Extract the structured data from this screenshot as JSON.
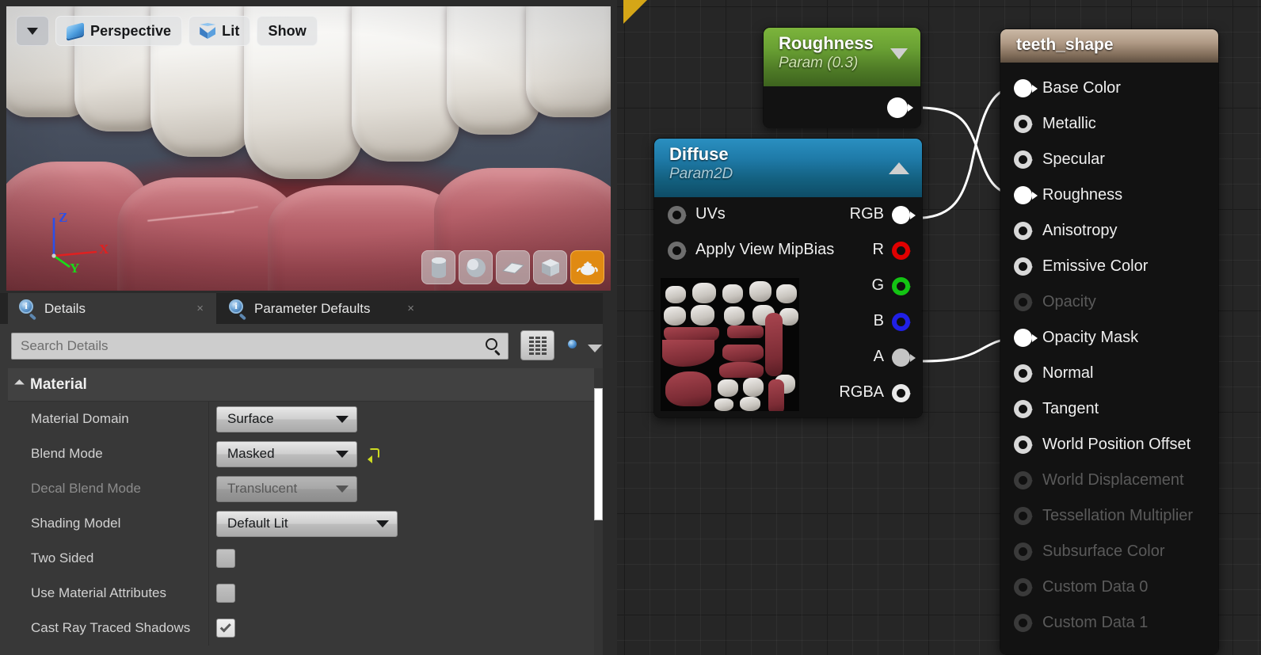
{
  "viewport": {
    "toolbar": {
      "menu_icon": "chevron-down-icon",
      "perspective_label": "Perspective",
      "perspective_icon": "perspective-icon",
      "lit_label": "Lit",
      "lit_icon": "lit-cube-icon",
      "show_label": "Show"
    },
    "gizmo": {
      "x_label": "X",
      "y_label": "Y",
      "z_label": "Z",
      "x_color": "#e02020",
      "y_color": "#18dc18",
      "z_color": "#2b4fe8"
    },
    "primitives": [
      {
        "name": "cylinder",
        "active": false
      },
      {
        "name": "sphere",
        "active": false
      },
      {
        "name": "plane",
        "active": false
      },
      {
        "name": "cube",
        "active": false
      },
      {
        "name": "teapot",
        "active": true
      }
    ],
    "primitive_active_color": "#e08a12"
  },
  "details": {
    "tabs": [
      {
        "label": "Details",
        "icon": "details-icon",
        "active": true,
        "close": "×"
      },
      {
        "label": "Parameter Defaults",
        "icon": "details-icon",
        "active": false,
        "close": "×"
      }
    ],
    "search": {
      "placeholder": "Search Details",
      "value": "",
      "icon": "search-icon"
    },
    "view_buttons": [
      {
        "name": "grid-view-button",
        "icon": "grid-icon"
      },
      {
        "name": "visibility-button",
        "icon": "eye-icon"
      },
      {
        "name": "view-options-dropdown",
        "icon": "chevron-down-icon"
      }
    ],
    "category": "Material",
    "rows": [
      {
        "name": "Material Domain",
        "type": "combo",
        "value": "Surface",
        "width": "w178",
        "disabled": false,
        "revert": false
      },
      {
        "name": "Blend Mode",
        "type": "combo",
        "value": "Masked",
        "width": "w178",
        "disabled": false,
        "revert": true
      },
      {
        "name": "Decal Blend Mode",
        "type": "combo",
        "value": "Translucent",
        "width": "w178",
        "disabled": true,
        "revert": false
      },
      {
        "name": "Shading Model",
        "type": "combo",
        "value": "Default Lit",
        "width": "w229",
        "disabled": false,
        "revert": false
      },
      {
        "name": "Two Sided",
        "type": "checkbox",
        "checked": false,
        "disabled": false,
        "revert": false
      },
      {
        "name": "Use Material Attributes",
        "type": "checkbox",
        "checked": false,
        "disabled": false,
        "revert": false
      },
      {
        "name": "Cast Ray Traced Shadows",
        "type": "checkbox",
        "checked": true,
        "disabled": false,
        "revert": false
      }
    ]
  },
  "graph": {
    "nodes": {
      "roughness": {
        "title": "Roughness",
        "subtitle": "Param (0.3)",
        "header_color": "#69a033",
        "collapse_icon": "chevron-down-icon",
        "output_pin": "roughness-output-pin"
      },
      "diffuse": {
        "title": "Diffuse",
        "subtitle": "Param2D",
        "header_color": "#1f7ba9",
        "collapse_icon": "chevron-up-icon",
        "inputs": [
          {
            "label": "UVs"
          },
          {
            "label": "Apply View MipBias"
          }
        ],
        "outputs": [
          {
            "label": "RGB",
            "style": "white",
            "connected": true
          },
          {
            "label": "R",
            "style": "ring r",
            "connected": false
          },
          {
            "label": "G",
            "style": "ring g",
            "connected": false
          },
          {
            "label": "B",
            "style": "ring b",
            "connected": false
          },
          {
            "label": "A",
            "style": "greyfill",
            "connected": true
          },
          {
            "label": "RGBA",
            "style": "ring w",
            "connected": false
          }
        ],
        "thumbnail": "teeth-texture-atlas-thumbnail"
      },
      "result": {
        "title": "teeth_shape",
        "header_color": "#b09a85",
        "pins": [
          {
            "label": "Base Color",
            "connected": true,
            "disabled": false
          },
          {
            "label": "Metallic",
            "connected": false,
            "disabled": false
          },
          {
            "label": "Specular",
            "connected": false,
            "disabled": false
          },
          {
            "label": "Roughness",
            "connected": true,
            "disabled": false
          },
          {
            "label": "Anisotropy",
            "connected": false,
            "disabled": false
          },
          {
            "label": "Emissive Color",
            "connected": false,
            "disabled": false
          },
          {
            "label": "Opacity",
            "connected": false,
            "disabled": true
          },
          {
            "label": "Opacity Mask",
            "connected": true,
            "disabled": false
          },
          {
            "label": "Normal",
            "connected": false,
            "disabled": false
          },
          {
            "label": "Tangent",
            "connected": false,
            "disabled": false
          },
          {
            "label": "World Position Offset",
            "connected": false,
            "disabled": false
          },
          {
            "label": "World Displacement",
            "connected": false,
            "disabled": true
          },
          {
            "label": "Tessellation Multiplier",
            "connected": false,
            "disabled": true
          },
          {
            "label": "Subsurface Color",
            "connected": false,
            "disabled": true
          },
          {
            "label": "Custom Data 0",
            "connected": false,
            "disabled": true
          },
          {
            "label": "Custom Data 1",
            "connected": false,
            "disabled": true
          }
        ]
      }
    },
    "wire_color": "#ffffff",
    "background_color": "#262626",
    "corner_marker_color": "#d5a617"
  }
}
